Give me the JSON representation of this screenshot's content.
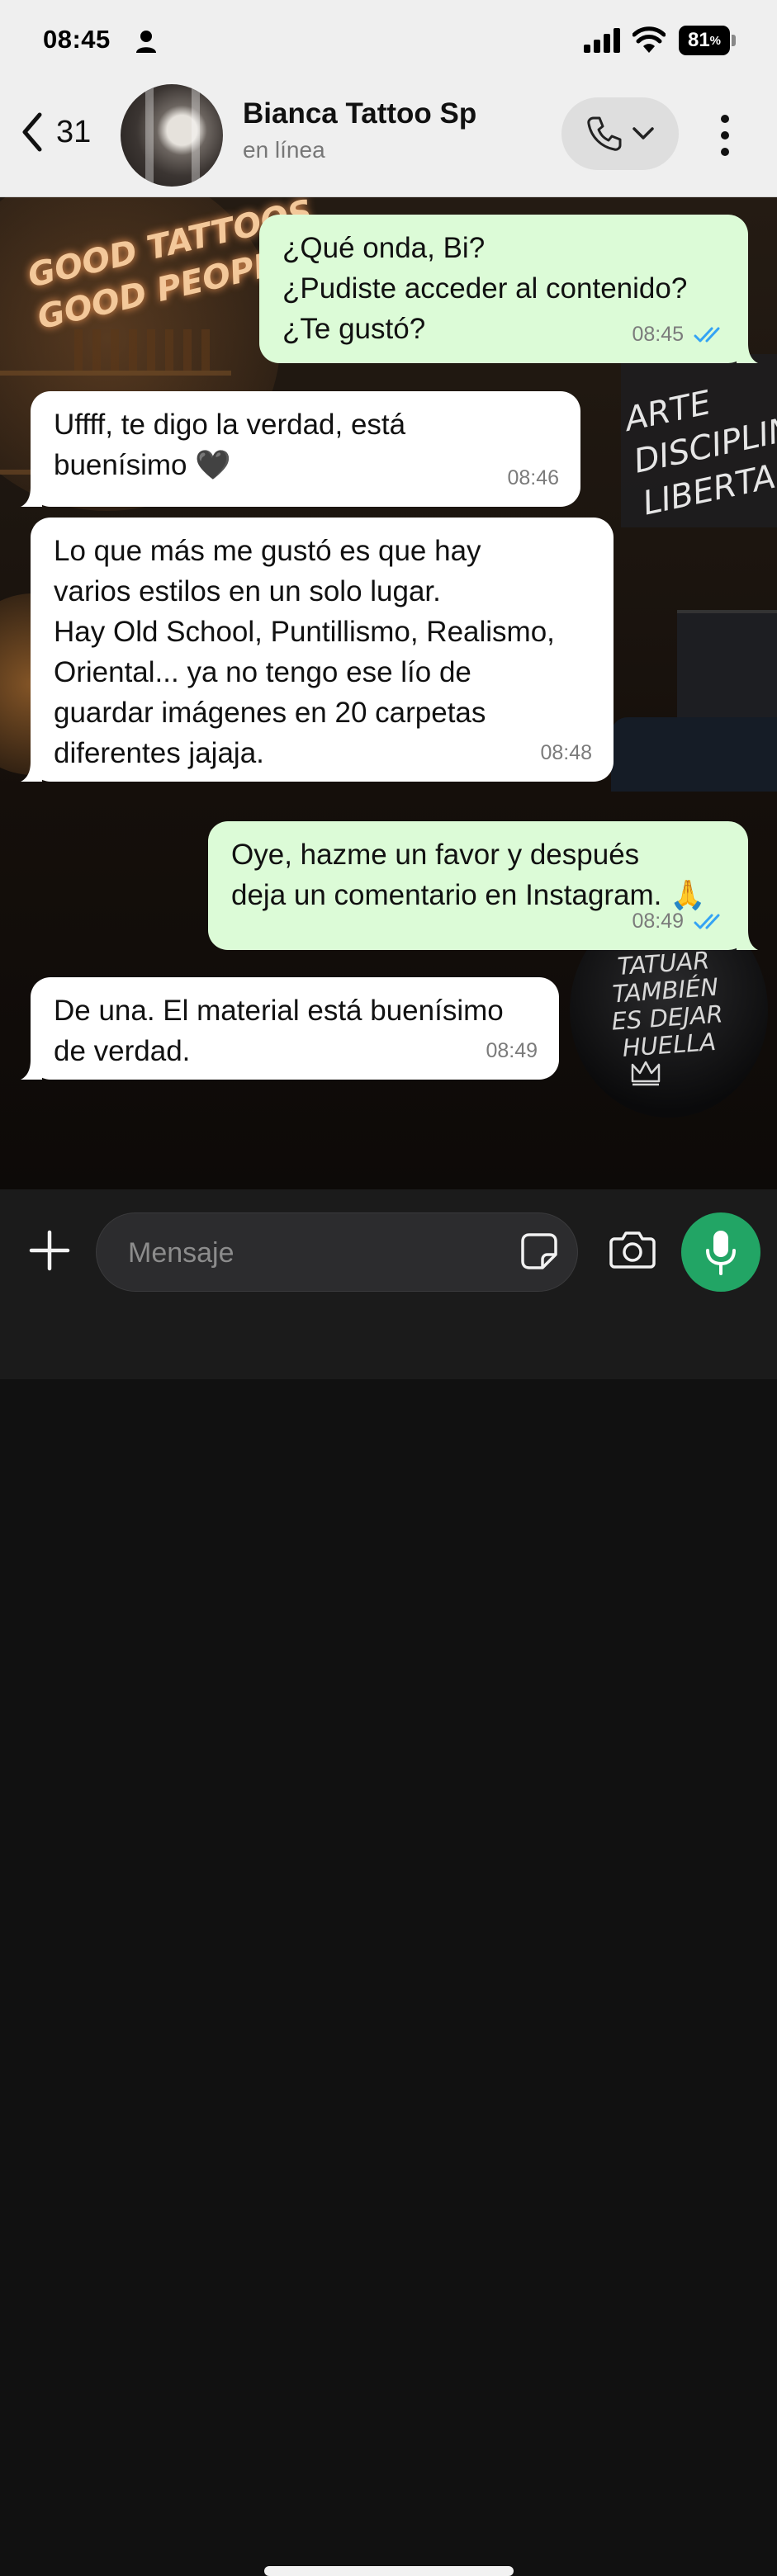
{
  "status_bar": {
    "time": "08:45",
    "battery_level": "81",
    "battery_unit": "%",
    "icons": [
      "person-icon",
      "cellular-signal-icon",
      "wifi-icon",
      "battery-icon"
    ]
  },
  "header": {
    "back_count": "31",
    "contact_name": "Bianca Tattoo Sp",
    "contact_status": "en línea",
    "icons": [
      "chevron-left-icon",
      "phone-icon",
      "chevron-down-icon",
      "more-vertical-icon"
    ]
  },
  "background_art": {
    "neon_sign": "GOOD TATTOOS\nGOOD PEOPLE",
    "wall_text": "ARTE\nDISCIPLINA\nLIBERTAD",
    "stool_text": "TATUAR\nTAMBIÉN\nES DEJAR\nHUELLA"
  },
  "messages": [
    {
      "direction": "out",
      "text": "¿Qué onda, Bi?\n¿Pudiste acceder al contenido?\n¿Te gustó?",
      "time": "08:45",
      "status": "read"
    },
    {
      "direction": "in",
      "text": "Uffff, te digo la verdad, está\nbuenísimo 🖤",
      "time": "08:46"
    },
    {
      "direction": "in",
      "text": "Lo que más me gustó es que hay\nvarios estilos en un solo lugar.\nHay Old School, Puntillismo, Realismo,\nOriental... ya no tengo ese lío de\nguardar imágenes en 20 carpetas\ndiferentes jajaja.",
      "time": "08:48"
    },
    {
      "direction": "out",
      "text": "Oye, hazme un favor y después\ndeja un comentario en Instagram. 🙏",
      "time": "08:49",
      "status": "read"
    },
    {
      "direction": "in",
      "text": "De una. El material está buenísimo\nde verdad.",
      "time": "08:49"
    }
  ],
  "composer": {
    "placeholder": "Mensaje",
    "value": "",
    "icons": [
      "plus-icon",
      "sticker-icon",
      "camera-icon",
      "microphone-icon"
    ]
  },
  "colors": {
    "outgoing_bubble": "#dcfbd7",
    "incoming_bubble": "#ffffff",
    "read_check": "#34a3f4",
    "mic_button": "#22a565"
  }
}
